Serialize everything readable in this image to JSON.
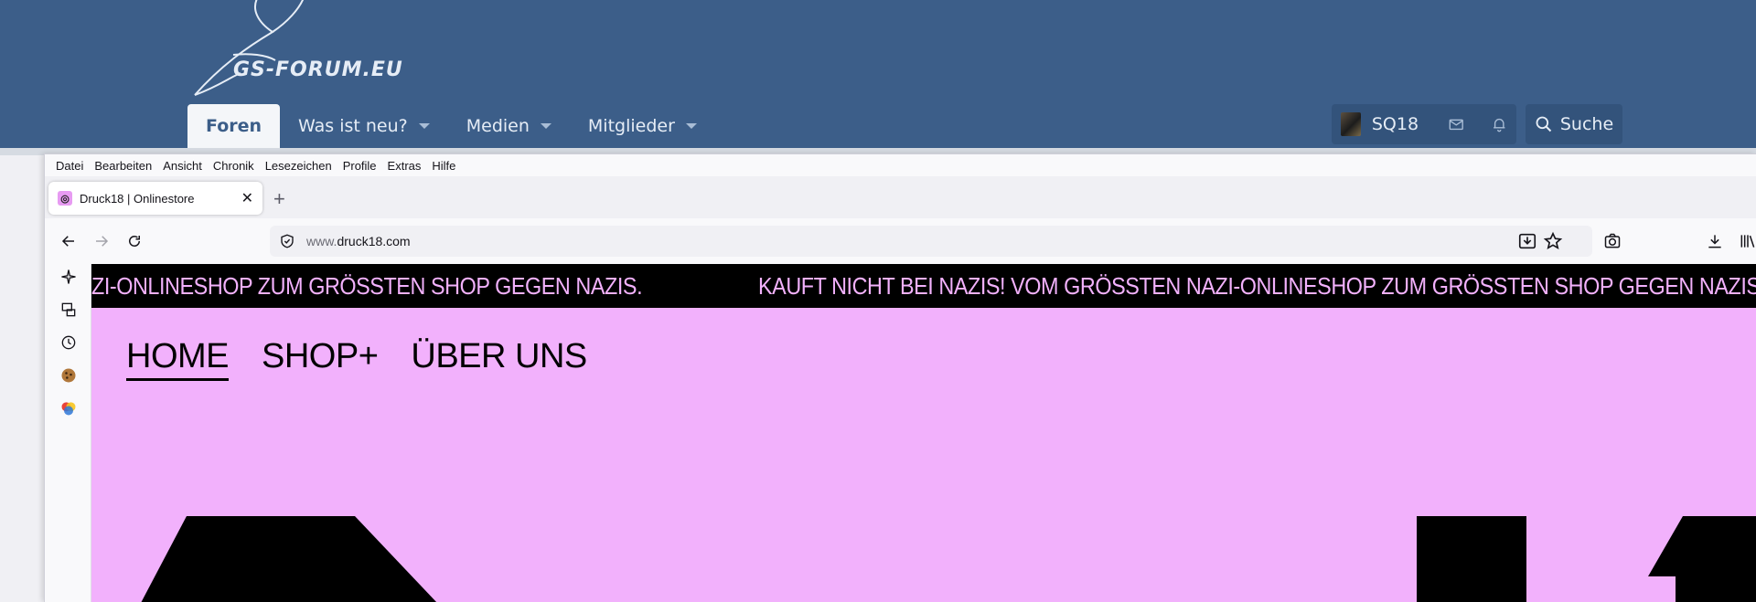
{
  "forum": {
    "logo_text": "GS-FORUM.EU",
    "nav": [
      {
        "label": "Foren",
        "active": true,
        "dropdown": false
      },
      {
        "label": "Was ist neu?",
        "active": false,
        "dropdown": true
      },
      {
        "label": "Medien",
        "active": false,
        "dropdown": true
      },
      {
        "label": "Mitglieder",
        "active": false,
        "dropdown": true
      }
    ],
    "username": "SQ18",
    "search_label": "Suche",
    "header_color": "#3c5e89"
  },
  "browser": {
    "menu": [
      "Datei",
      "Bearbeiten",
      "Ansicht",
      "Chronik",
      "Lesezeichen",
      "Profile",
      "Extras",
      "Hilfe"
    ],
    "tab": {
      "title": "Druck18 | Onlinestore",
      "close": "✕"
    },
    "newtab": "+",
    "url_prefix": "www.",
    "url_domain": "druck18.com",
    "sidebar_icons": [
      "ai-chat-icon",
      "synced-tabs-icon",
      "history-icon",
      "cookie-icon",
      "extension-icon"
    ]
  },
  "site": {
    "ticker_1": "ZI-ONLINESHOP ZUM GRÖSSTEN SHOP GEGEN NAZIS.",
    "ticker_2": "KAUFT NICHT BEI NAZIS! VOM GRÖSSTEN NAZI-ONLINESHOP ZUM GRÖSSTEN SHOP GEGEN NAZIS.",
    "nav": [
      {
        "label": "HOME",
        "active": true
      },
      {
        "label": "SHOP+",
        "active": false
      },
      {
        "label": "ÜBER UNS",
        "active": false
      }
    ],
    "bg_color": "#f2b1fc",
    "ticker_bg": "#000000"
  }
}
